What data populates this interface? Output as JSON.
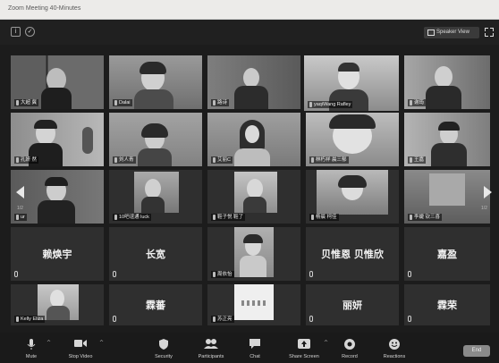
{
  "window": {
    "title": "Zoom Meeting 40-Minutes"
  },
  "topbar": {
    "speaker_view": "Speaker View"
  },
  "pager": {
    "left": "1/2",
    "right": "1/2"
  },
  "tiles": [
    {
      "name": "大超 冀"
    },
    {
      "name": "Dalai"
    },
    {
      "name": "路诗"
    },
    {
      "name": "yaqiWang Rafley"
    },
    {
      "name": "谢筠"
    },
    {
      "name": "孔妍 然"
    },
    {
      "name": "刘人青"
    },
    {
      "name": "艾丽C"
    },
    {
      "name": "林朽祥 晨三郁"
    },
    {
      "name": "王嘉"
    },
    {
      "name": "ur"
    },
    {
      "name": "10吧谊通 luck"
    },
    {
      "name": "鞋子悦 鞋了"
    },
    {
      "name": "杨晨 柯佳"
    },
    {
      "name": "李婕 钦三喜"
    },
    {
      "name": "赖焕宇",
      "big": "赖焕宇"
    },
    {
      "name": "长宽",
      "big": "长宽"
    },
    {
      "name": "周依怡"
    },
    {
      "name": "贝惟恩 贝惟欣",
      "big": "贝惟恩 贝惟欣"
    },
    {
      "name": "嘉盈",
      "big": "嘉盈"
    },
    {
      "name": "Kelly Eliza"
    },
    {
      "name": "霖蕃",
      "big": "霖蕃"
    },
    {
      "name": "苏正亮"
    },
    {
      "name": "丽妍",
      "big": "丽妍"
    },
    {
      "name": "霖荣",
      "big": "霖荣"
    }
  ],
  "toolbar": {
    "mute": "Mute",
    "stop_video": "Stop Video",
    "security": "Security",
    "participants": "Participants",
    "chat": "Chat",
    "share_screen": "Share Screen",
    "record": "Record",
    "reactions": "Reactions",
    "end": "End"
  }
}
